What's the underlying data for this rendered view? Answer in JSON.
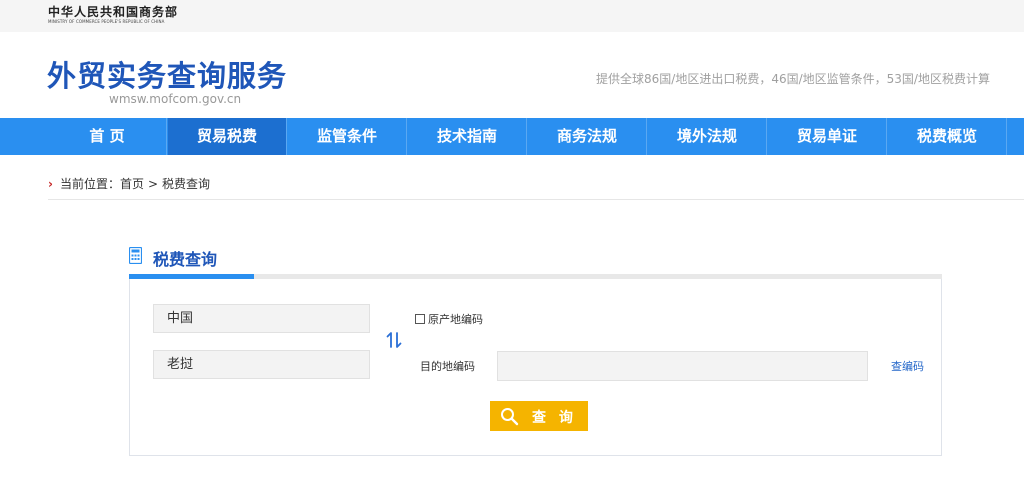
{
  "header": {
    "ministry_cn": "中华人民共和国商务部",
    "ministry_en": "MINISTRY OF COMMERCE PEOPLE'S REPUBLIC OF CHINA",
    "site_title": "外贸实务查询服务",
    "site_domain": "wmsw.mofcom.gov.cn",
    "site_desc": "提供全球86国/地区进出口税费，46国/地区监管条件，53国/地区税费计算"
  },
  "nav": {
    "items": [
      {
        "label": "首 页"
      },
      {
        "label": "贸易税费"
      },
      {
        "label": "监管条件"
      },
      {
        "label": "技术指南"
      },
      {
        "label": "商务法规"
      },
      {
        "label": "境外法规"
      },
      {
        "label": "贸易单证"
      },
      {
        "label": "税费概览"
      }
    ],
    "active_index": 1
  },
  "breadcrumb": {
    "prefix": "当前位置：",
    "home": "首页",
    "separator": ">",
    "current": "税费查询"
  },
  "panel": {
    "title": "税费查询",
    "origin_country": "中国",
    "destination_country": "老挝",
    "origin_code_checkbox_label": "原产地编码",
    "origin_code_checked": false,
    "dest_code_label": "目的地编码",
    "dest_code_value": "",
    "lookup_code_link": "查编码",
    "search_button": "查 询"
  },
  "colors": {
    "nav_bg": "#2a8ff0",
    "nav_active": "#1c6fd0",
    "title_blue": "#1f56b8",
    "search_button": "#f5b400",
    "breadcrumb_arrow": "#c62828"
  }
}
